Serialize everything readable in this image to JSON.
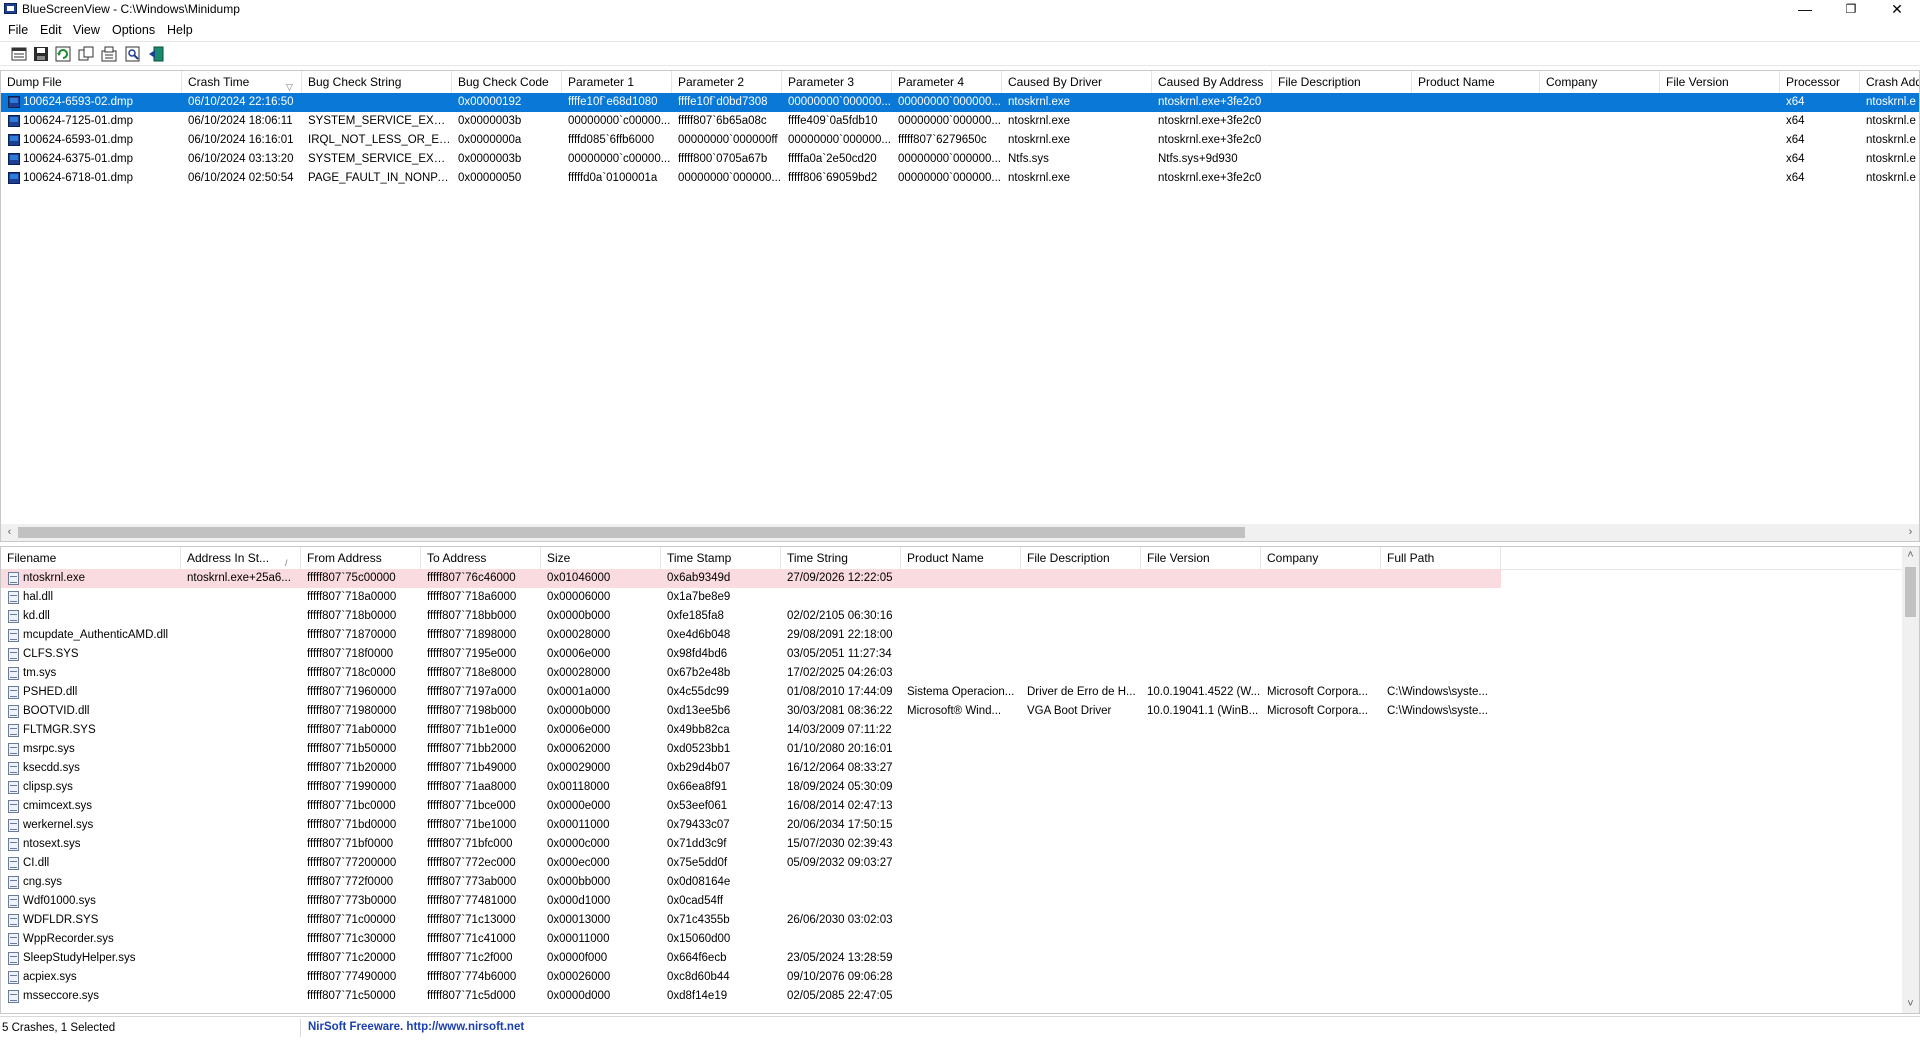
{
  "window": {
    "title": "BlueScreenView  -  C:\\Windows\\Minidump",
    "minimize": "—",
    "restore": "❐",
    "close": "✕"
  },
  "menu": [
    "File",
    "Edit",
    "View",
    "Options",
    "Help"
  ],
  "toolbar": [
    "save-icon",
    "save-selected-icon",
    "refresh-icon",
    "copy-icon",
    "properties-icon",
    "find-icon",
    "exit-icon"
  ],
  "crashes": {
    "columns": [
      {
        "label": "Dump File"
      },
      {
        "label": "Crash Time",
        "sort": "▽"
      },
      {
        "label": "Bug Check String"
      },
      {
        "label": "Bug Check Code"
      },
      {
        "label": "Parameter 1"
      },
      {
        "label": "Parameter 2"
      },
      {
        "label": "Parameter 3"
      },
      {
        "label": "Parameter 4"
      },
      {
        "label": "Caused By Driver"
      },
      {
        "label": "Caused By Address"
      },
      {
        "label": "File Description"
      },
      {
        "label": "Product Name"
      },
      {
        "label": "Company"
      },
      {
        "label": "File Version"
      },
      {
        "label": "Processor"
      },
      {
        "label": "Crash Address"
      }
    ],
    "rows": [
      [
        "100624-6593-02.dmp",
        "06/10/2024 22:16:50",
        "",
        "0x00000192",
        "ffffe10f`e68d1080",
        "ffffe10f`d0bd7308",
        "00000000`000000...",
        "00000000`000000...",
        "ntoskrnl.exe",
        "ntoskrnl.exe+3fe2c0",
        "",
        "",
        "",
        "",
        "x64",
        "ntoskrnl.e"
      ],
      [
        "100624-7125-01.dmp",
        "06/10/2024 18:06:11",
        "SYSTEM_SERVICE_EXCEP...",
        "0x0000003b",
        "00000000`c00000...",
        "fffff807`6b65a08c",
        "ffffe409`0a5fdb10",
        "00000000`000000...",
        "ntoskrnl.exe",
        "ntoskrnl.exe+3fe2c0",
        "",
        "",
        "",
        "",
        "x64",
        "ntoskrnl.e"
      ],
      [
        "100624-6593-01.dmp",
        "06/10/2024 16:16:01",
        "IRQL_NOT_LESS_OR_EQ...",
        "0x0000000a",
        "ffffd085`6ffb6000",
        "00000000`000000ff",
        "00000000`000000...",
        "fffff807`6279650c",
        "ntoskrnl.exe",
        "ntoskrnl.exe+3fe2c0",
        "",
        "",
        "",
        "",
        "x64",
        "ntoskrnl.e"
      ],
      [
        "100624-6375-01.dmp",
        "06/10/2024 03:13:20",
        "SYSTEM_SERVICE_EXCEP...",
        "0x0000003b",
        "00000000`c00000...",
        "fffff800`0705a67b",
        "fffffa0a`2e50cd20",
        "00000000`000000...",
        "Ntfs.sys",
        "Ntfs.sys+9d930",
        "",
        "",
        "",
        "",
        "x64",
        "ntoskrnl.e"
      ],
      [
        "100624-6718-01.dmp",
        "06/10/2024 02:50:54",
        "PAGE_FAULT_IN_NONPA...",
        "0x00000050",
        "fffffd0a`0100001a",
        "00000000`000000...",
        "fffff806`69059bd2",
        "00000000`000000...",
        "ntoskrnl.exe",
        "ntoskrnl.exe+3fe2c0",
        "",
        "",
        "",
        "",
        "x64",
        "ntoskrnl.e"
      ]
    ]
  },
  "drivers": {
    "columns": [
      {
        "label": "Filename"
      },
      {
        "label": "Address In St...",
        "sort": "/"
      },
      {
        "label": "From Address"
      },
      {
        "label": "To Address"
      },
      {
        "label": "Size"
      },
      {
        "label": "Time Stamp"
      },
      {
        "label": "Time String"
      },
      {
        "label": "Product Name"
      },
      {
        "label": "File Description"
      },
      {
        "label": "File Version"
      },
      {
        "label": "Company"
      },
      {
        "label": "Full Path"
      }
    ],
    "rows": [
      [
        "ntoskrnl.exe",
        "ntoskrnl.exe+25a6...",
        "fffff807`75c00000",
        "fffff807`76c46000",
        "0x01046000",
        "0x6ab9349d",
        "27/09/2026 12:22:05",
        "",
        "",
        "",
        "",
        ""
      ],
      [
        "hal.dll",
        "",
        "fffff807`718a0000",
        "fffff807`718a6000",
        "0x00006000",
        "0x1a7be8e9",
        "",
        "",
        "",
        "",
        "",
        ""
      ],
      [
        "kd.dll",
        "",
        "fffff807`718b0000",
        "fffff807`718bb000",
        "0x0000b000",
        "0xfe185fa8",
        "02/02/2105 06:30:16",
        "",
        "",
        "",
        "",
        ""
      ],
      [
        "mcupdate_AuthenticAMD.dll",
        "",
        "fffff807`71870000",
        "fffff807`71898000",
        "0x00028000",
        "0xe4d6b048",
        "29/08/2091 22:18:00",
        "",
        "",
        "",
        "",
        ""
      ],
      [
        "CLFS.SYS",
        "",
        "fffff807`718f0000",
        "fffff807`7195e000",
        "0x0006e000",
        "0x98fd4bd6",
        "03/05/2051 11:27:34",
        "",
        "",
        "",
        "",
        ""
      ],
      [
        "tm.sys",
        "",
        "fffff807`718c0000",
        "fffff807`718e8000",
        "0x00028000",
        "0x67b2e48b",
        "17/02/2025 04:26:03",
        "",
        "",
        "",
        "",
        ""
      ],
      [
        "PSHED.dll",
        "",
        "fffff807`71960000",
        "fffff807`7197a000",
        "0x0001a000",
        "0x4c55dc99",
        "01/08/2010 17:44:09",
        "Sistema Operacion...",
        "Driver de Erro de H...",
        "10.0.19041.4522 (W...",
        "Microsoft Corpora...",
        "C:\\Windows\\syste..."
      ],
      [
        "BOOTVID.dll",
        "",
        "fffff807`71980000",
        "fffff807`7198b000",
        "0x0000b000",
        "0xd13ee5b6",
        "30/03/2081 08:36:22",
        "Microsoft® Wind...",
        "VGA Boot Driver",
        "10.0.19041.1 (WinB...",
        "Microsoft Corpora...",
        "C:\\Windows\\syste..."
      ],
      [
        "FLTMGR.SYS",
        "",
        "fffff807`71ab0000",
        "fffff807`71b1e000",
        "0x0006e000",
        "0x49bb82ca",
        "14/03/2009 07:11:22",
        "",
        "",
        "",
        "",
        ""
      ],
      [
        "msrpc.sys",
        "",
        "fffff807`71b50000",
        "fffff807`71bb2000",
        "0x00062000",
        "0xd0523bb1",
        "01/10/2080 20:16:01",
        "",
        "",
        "",
        "",
        ""
      ],
      [
        "ksecdd.sys",
        "",
        "fffff807`71b20000",
        "fffff807`71b49000",
        "0x00029000",
        "0xb29d4b07",
        "16/12/2064 08:33:27",
        "",
        "",
        "",
        "",
        ""
      ],
      [
        "clipsp.sys",
        "",
        "fffff807`71990000",
        "fffff807`71aa8000",
        "0x00118000",
        "0x66ea8f91",
        "18/09/2024 05:30:09",
        "",
        "",
        "",
        "",
        ""
      ],
      [
        "cmimcext.sys",
        "",
        "fffff807`71bc0000",
        "fffff807`71bce000",
        "0x0000e000",
        "0x53eef061",
        "16/08/2014 02:47:13",
        "",
        "",
        "",
        "",
        ""
      ],
      [
        "werkernel.sys",
        "",
        "fffff807`71bd0000",
        "fffff807`71be1000",
        "0x00011000",
        "0x79433c07",
        "20/06/2034 17:50:15",
        "",
        "",
        "",
        "",
        ""
      ],
      [
        "ntosext.sys",
        "",
        "fffff807`71bf0000",
        "fffff807`71bfc000",
        "0x0000c000",
        "0x71dd3c9f",
        "15/07/2030 02:39:43",
        "",
        "",
        "",
        "",
        ""
      ],
      [
        "CI.dll",
        "",
        "fffff807`77200000",
        "fffff807`772ec000",
        "0x000ec000",
        "0x75e5dd0f",
        "05/09/2032 09:03:27",
        "",
        "",
        "",
        "",
        ""
      ],
      [
        "cng.sys",
        "",
        "fffff807`772f0000",
        "fffff807`773ab000",
        "0x000bb000",
        "0x0d08164e",
        "",
        "",
        "",
        "",
        "",
        ""
      ],
      [
        "Wdf01000.sys",
        "",
        "fffff807`773b0000",
        "fffff807`77481000",
        "0x000d1000",
        "0x0cad54ff",
        "",
        "",
        "",
        "",
        "",
        ""
      ],
      [
        "WDFLDR.SYS",
        "",
        "fffff807`71c00000",
        "fffff807`71c13000",
        "0x00013000",
        "0x71c4355b",
        "26/06/2030 03:02:03",
        "",
        "",
        "",
        "",
        ""
      ],
      [
        "WppRecorder.sys",
        "",
        "fffff807`71c30000",
        "fffff807`71c41000",
        "0x00011000",
        "0x15060d00",
        "",
        "",
        "",
        "",
        "",
        ""
      ],
      [
        "SleepStudyHelper.sys",
        "",
        "fffff807`71c20000",
        "fffff807`71c2f000",
        "0x0000f000",
        "0x664f6ecb",
        "23/05/2024 13:28:59",
        "",
        "",
        "",
        "",
        ""
      ],
      [
        "acpiex.sys",
        "",
        "fffff807`77490000",
        "fffff807`774b6000",
        "0x00026000",
        "0xc8d60b44",
        "09/10/2076 09:06:28",
        "",
        "",
        "",
        "",
        ""
      ],
      [
        "msseccore.sys",
        "",
        "fffff807`71c50000",
        "fffff807`71c5d000",
        "0x0000d000",
        "0xd8f14e19",
        "02/05/2085 22:47:05",
        "",
        "",
        "",
        "",
        ""
      ]
    ]
  },
  "status": {
    "left": "5 Crashes, 1 Selected",
    "right": "NirSoft Freeware.  http://www.nirsoft.net"
  },
  "colors": {
    "selection": "#0a78d7",
    "highlight_row": "#fadbdf",
    "link": "#1a3fb0"
  }
}
